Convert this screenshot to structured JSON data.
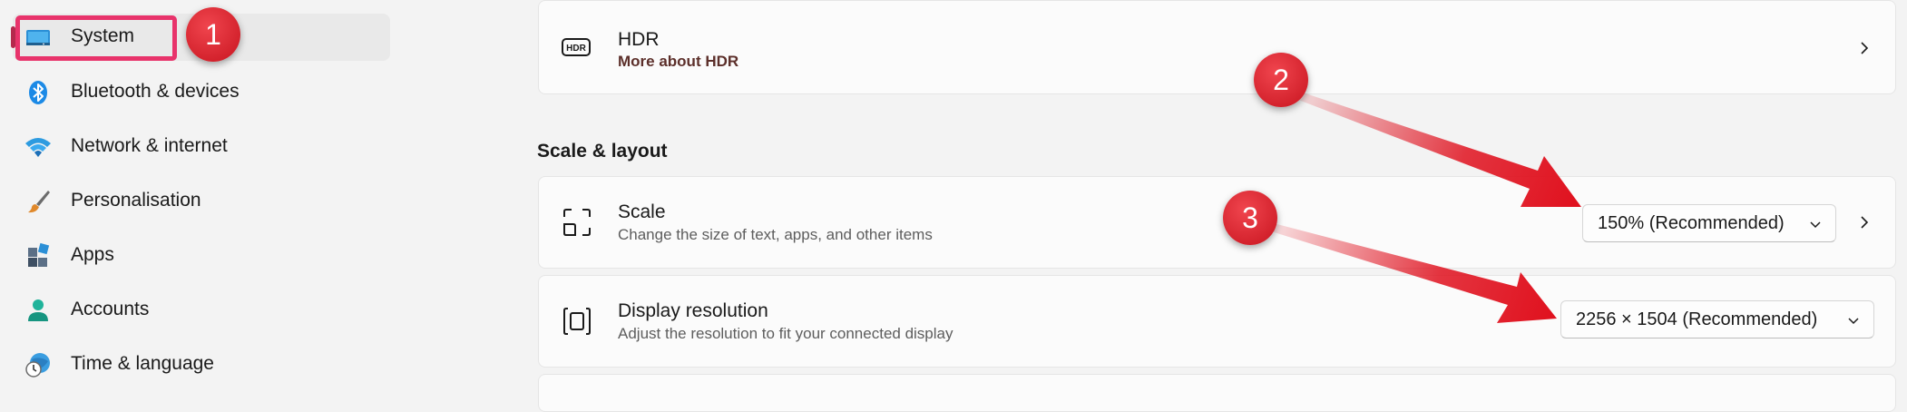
{
  "sidebar": {
    "items": [
      {
        "label": "System",
        "icon": "monitor-icon"
      },
      {
        "label": "Bluetooth & devices",
        "icon": "bluetooth-icon"
      },
      {
        "label": "Network & internet",
        "icon": "wifi-icon"
      },
      {
        "label": "Personalisation",
        "icon": "paintbrush-icon"
      },
      {
        "label": "Apps",
        "icon": "apps-icon"
      },
      {
        "label": "Accounts",
        "icon": "person-icon"
      },
      {
        "label": "Time & language",
        "icon": "globe-clock-icon"
      }
    ]
  },
  "hdr": {
    "title": "HDR",
    "link": "More about HDR",
    "icon_text": "HDR"
  },
  "scale_layout": {
    "heading": "Scale & layout",
    "scale": {
      "title": "Scale",
      "subtitle": "Change the size of text, apps, and other items",
      "value": "150% (Recommended)"
    },
    "resolution": {
      "title": "Display resolution",
      "subtitle": "Adjust the resolution to fit your connected display",
      "value": "2256 × 1504 (Recommended)"
    }
  },
  "annotations": {
    "badge1": "1",
    "badge2": "2",
    "badge3": "3"
  },
  "colors": {
    "accent": "#b5294d",
    "highlight": "#e8336b",
    "annotation_red": "#e0121f"
  }
}
